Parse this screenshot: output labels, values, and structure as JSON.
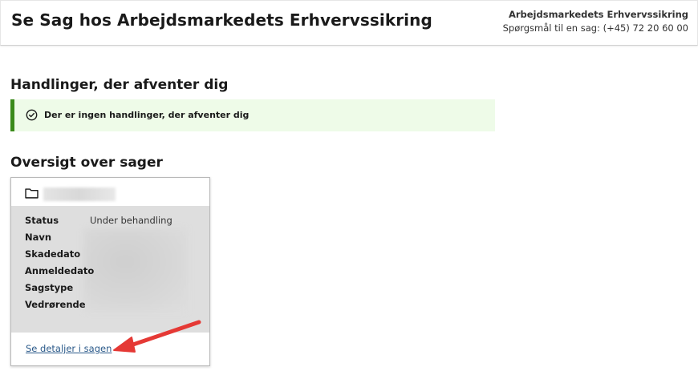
{
  "header": {
    "title": "Se Sag hos Arbejdsmarkedets Erhvervssikring",
    "organization": "Arbejdsmarkedets Erhvervssikring",
    "phone_line": "Spørgsmål til en sag: (+45) 72 20 60 00"
  },
  "actions": {
    "title": "Handlinger, der afventer dig",
    "alert_text": "Der er ingen handlinger, der afventer dig",
    "alert_icon": "check-circle-icon"
  },
  "overview": {
    "title": "Oversigt over sager",
    "card": {
      "icon": "folder-icon",
      "rows": [
        {
          "label": "Status",
          "value": "Under behandling"
        },
        {
          "label": "Navn",
          "value": ""
        },
        {
          "label": "Skadedato",
          "value": ""
        },
        {
          "label": "Anmeldedato",
          "value": ""
        },
        {
          "label": "Sagstype",
          "value": ""
        },
        {
          "label": "Vedrørende",
          "value": ""
        }
      ],
      "link_label": "Se detaljer i sagen"
    }
  },
  "colors": {
    "alert_bg": "#eefbe8",
    "alert_border": "#3a8a1a",
    "link": "#2b5a8a",
    "arrow": "#e53935"
  }
}
